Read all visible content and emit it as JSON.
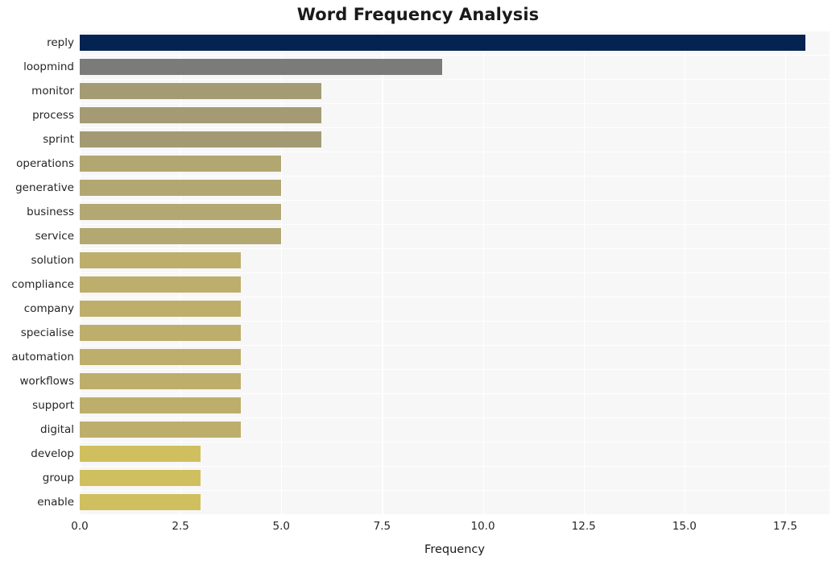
{
  "chart_data": {
    "type": "bar",
    "orientation": "horizontal",
    "title": "Word Frequency Analysis",
    "xlabel": "Frequency",
    "ylabel": "",
    "categories": [
      "reply",
      "loopmind",
      "monitor",
      "process",
      "sprint",
      "operations",
      "generative",
      "business",
      "service",
      "solution",
      "compliance",
      "company",
      "specialise",
      "automation",
      "workflows",
      "support",
      "digital",
      "develop",
      "group",
      "enable"
    ],
    "values": [
      18,
      9,
      6,
      6,
      6,
      5,
      5,
      5,
      5,
      4,
      4,
      4,
      4,
      4,
      4,
      4,
      4,
      3,
      3,
      3
    ],
    "bar_colors": [
      "#052350",
      "#7b7b79",
      "#a49b74",
      "#a49b74",
      "#a39a73",
      "#b2a771",
      "#b2a771",
      "#b3a872",
      "#b3a872",
      "#bdae6c",
      "#bdae6c",
      "#bdae6c",
      "#bdae6c",
      "#bdae6c",
      "#bdae6c",
      "#bdae6c",
      "#bdae6c",
      "#d0bf5e",
      "#d0bf5e",
      "#d0bf5e"
    ],
    "xlim": [
      0,
      18.6
    ],
    "xticks": [
      0,
      2.5,
      5,
      7.5,
      10,
      12.5,
      15,
      17.5
    ],
    "xtick_labels": [
      "0.0",
      "2.5",
      "5.0",
      "7.5",
      "10.0",
      "12.5",
      "15.0",
      "17.5"
    ],
    "grid": true,
    "grid_color": "#ffffff",
    "plot_background": "#f7f7f7",
    "figure_background": "#ffffff",
    "legend": null
  }
}
